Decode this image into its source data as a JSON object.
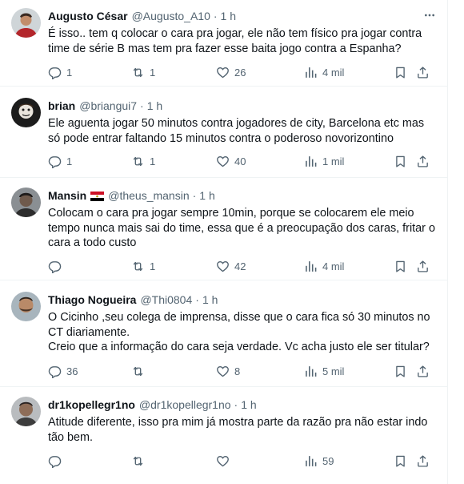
{
  "tweets": [
    {
      "name": "Augusto César",
      "handle": "@Augusto_A10",
      "sep": "·",
      "time": "1 h",
      "lines": [
        "É isso..  tem q colocar o cara pra jogar, ele não tem físico pra jogar contra",
        "time de série B mas tem pra fazer esse baita jogo contra a Espanha?"
      ],
      "replies": "1",
      "retweets": "1",
      "likes": "26",
      "views": "4 mil"
    },
    {
      "name": "brian",
      "handle": "@briangui7",
      "sep": "·",
      "time": "1 h",
      "lines": [
        "Ele aguenta jogar 50 minutos contra jogadores de city, Barcelona etc mas",
        "só pode entrar faltando 15 minutos contra o poderoso novorizontino"
      ],
      "replies": "1",
      "retweets": "1",
      "likes": "40",
      "views": "1 mil"
    },
    {
      "name": "Mansin",
      "flag_icon": "egypt-flag-icon",
      "handle": "@theus_mansin",
      "sep": "·",
      "time": "1 h",
      "lines": [
        "Colocam o cara pra jogar sempre 10min, porque se colocarem ele meio",
        "tempo nunca mais sai do time, essa que é a preocupação dos caras, fritar o",
        "cara a todo custo"
      ],
      "replies": "",
      "retweets": "1",
      "likes": "42",
      "views": "4 mil"
    },
    {
      "name": "Thiago Nogueira",
      "handle": "@Thi0804",
      "sep": "·",
      "time": "1 h",
      "lines": [
        "O Cicinho ,seu colega de imprensa, disse que o cara fica só 30 minutos no",
        "CT diariamente.",
        "Creio que a informação do cara seja verdade. Vc acha justo ele ser titular?"
      ],
      "replies": "36",
      "retweets": "",
      "likes": "8",
      "views": "5 mil"
    },
    {
      "name": "dr1kopellegr1no",
      "handle": "@dr1kopellegr1no",
      "sep": "·",
      "time": "1 h",
      "lines": [
        "Atitude diferente, isso pra mim já mostra parte da razão pra não estar indo",
        "tão bem."
      ],
      "replies": "",
      "retweets": "",
      "likes": "",
      "views": "59"
    }
  ],
  "colors": {
    "text": "#0f1419",
    "muted": "#536471",
    "divider": "#eff3f4"
  },
  "icons": [
    "reply-icon",
    "retweet-icon",
    "like-icon",
    "views-icon",
    "bookmark-icon",
    "share-icon",
    "more-icon"
  ]
}
